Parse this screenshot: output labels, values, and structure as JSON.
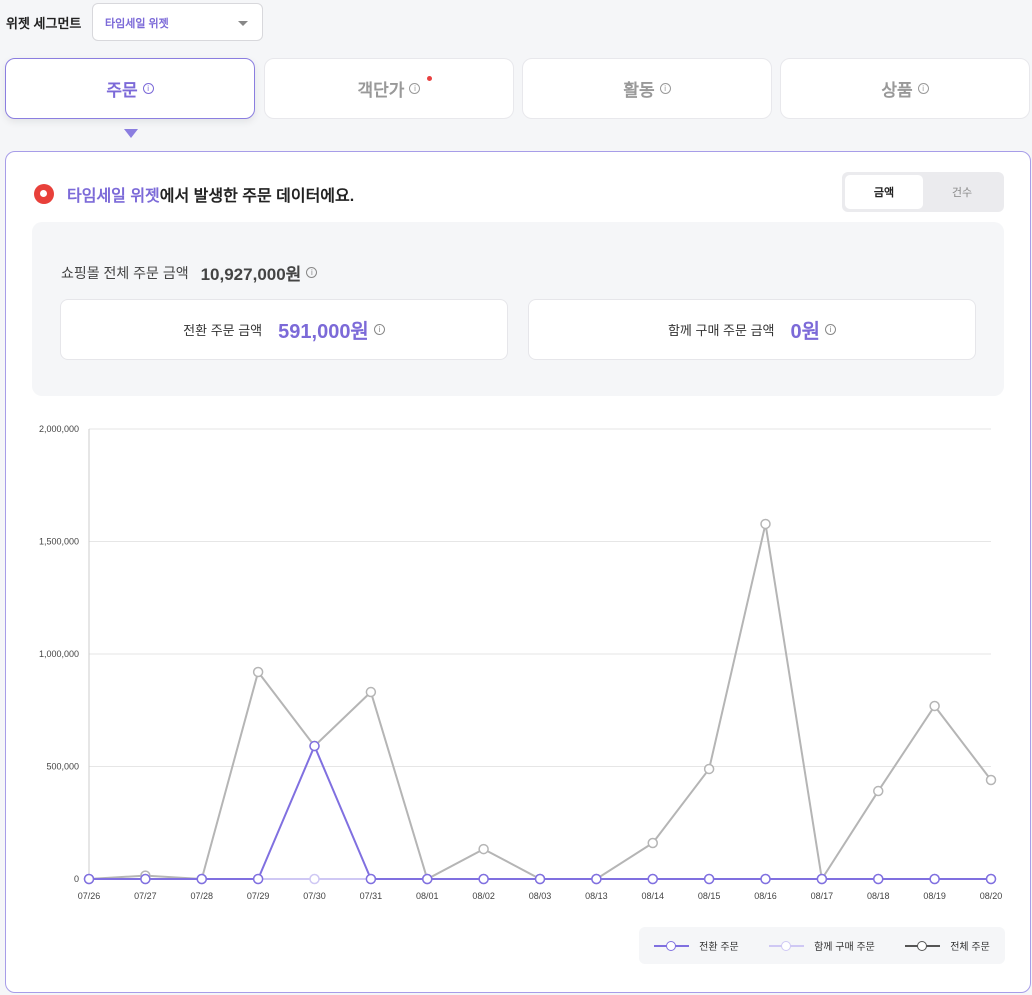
{
  "segment": {
    "label": "위젯 세그먼트",
    "selected": "타임세일 위젯"
  },
  "tabs": [
    {
      "label": "주문",
      "active": true
    },
    {
      "label": "객단가",
      "badge": true
    },
    {
      "label": "활동"
    },
    {
      "label": "상품"
    }
  ],
  "headline": {
    "highlight": "타임세일 위젯",
    "rest": "에서 발생한 주문 데이터에요."
  },
  "toggle": {
    "options": [
      "금액",
      "건수"
    ],
    "selected": "금액"
  },
  "summary": {
    "total_label": "쇼핑몰 전체 주문 금액",
    "total_value": "10,927,000원",
    "conv_label": "전환 주문 금액",
    "conv_value": "591,000원",
    "together_label": "함께 구매 주문 금액",
    "together_value": "0원"
  },
  "chart_data": {
    "type": "line",
    "categories": [
      "07/26",
      "07/27",
      "07/28",
      "07/29",
      "07/30",
      "07/31",
      "08/01",
      "08/02",
      "08/03",
      "08/13",
      "08/14",
      "08/15",
      "08/16",
      "08/17",
      "08/18",
      "08/19",
      "08/20"
    ],
    "ylim": [
      0,
      2000000
    ],
    "yticks": [
      "0",
      "500,000",
      "1,000,000",
      "1,500,000",
      "2,000,000"
    ],
    "grid": true,
    "legend_position": "bottom-right",
    "series": [
      {
        "name": "전환 주문",
        "color": "#8070e0",
        "values": [
          0,
          0,
          0,
          0,
          591000,
          0,
          0,
          0,
          0,
          0,
          0,
          0,
          0,
          0,
          0,
          0,
          0
        ]
      },
      {
        "name": "함께 구매 주문",
        "color": "#cfc8f4",
        "values": [
          0,
          0,
          0,
          0,
          0,
          0,
          0,
          0,
          0,
          0,
          0,
          0,
          0,
          0,
          0,
          0,
          0
        ]
      },
      {
        "name": "전체 주문",
        "color": "#b5b5b5",
        "values": [
          0,
          15000,
          0,
          920000,
          591000,
          831000,
          0,
          133000,
          0,
          0,
          160000,
          489000,
          1578000,
          0,
          391000,
          769000,
          440000
        ]
      }
    ]
  }
}
